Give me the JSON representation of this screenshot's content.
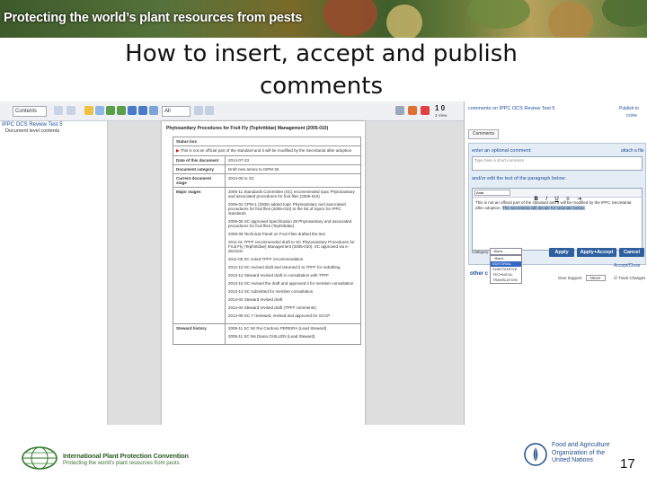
{
  "banner": {
    "text": "Protecting the world’s plant resources from pests"
  },
  "slide": {
    "title_line1": "How to insert, accept and publish",
    "title_line2": "comments",
    "page_number": "17"
  },
  "viewer": {
    "toolbar": {
      "contents_select": "Contents",
      "zoom_select": "All",
      "page_count": "1 0",
      "page_sub": "3 View"
    },
    "sidebar": {
      "tree_item": "IPPC OCS Review Test 5",
      "tree_sub": "Document level contents"
    },
    "document": {
      "title": "Phytosanitary Procedures for Fruit Fly (Tephritidae) Management (2005-010)",
      "rows": [
        {
          "key": "Status box",
          "value": ""
        },
        {
          "key": "",
          "value": "This is not an official part of the standard and it will be modified by the Secretariat after adoption"
        },
        {
          "key": "Date of this document",
          "value": "2014-07-23"
        },
        {
          "key": "Document category",
          "value": "Draft new annex to ISPM 26"
        },
        {
          "key": "Current document stage",
          "value": "2014-05 to SC"
        }
      ],
      "major_stages_key": "Major stages",
      "major_stages": [
        "2005-11 Standards Committee (SC) recommended topic Phytosanitary and associated procedures for fruit flies (2005-010)",
        "2006-04 CPM-1 (2006) added topic Phytosanitary and associated procedures for fruit flies (2005-010) to the list of topics for IPPC standards",
        "2009-05 SC approved Specification 28 Phytosanitary and associated procedures for fruit flies (Tephritidae)",
        "2009-09 Technical Panel on Fruit Flies drafted the text",
        "2011-01 TPFF recommended draft to SC Phytosanitary Procedures for Fruit Fly (Tephritidae) Management (2005-010), SC approved via e-decision",
        "2011-06 SC noted TPFF recommendation",
        "2012-10 SC revised draft and returned it to TPFF for redrafting",
        "2013-12 Steward revised draft in consultation with TPFF",
        "2013-10 SC revised the draft and approved it for member consultation",
        "2013-14 SC submitted for member consultation",
        "2014-02 Steward revised draft",
        "2014-04 Steward revised draft (TPFF comments)",
        "2014-05 SC-7 reviewed, revised and approved for SCCP"
      ],
      "steward_key": "Steward history",
      "steward_history": [
        "2009-11 SC Mr Rui Cardoso PEREIRA (Lead Steward)",
        "2005-11 SC Ms Diana GUILLÉN (Lead Steward)"
      ]
    },
    "comment_panel": {
      "header": "comments on IPPC OCS Review Test 5",
      "header_right": "Publish to",
      "header_right2": "cc/ee",
      "tab": "Comments",
      "optional_label": "enter an optional comment:",
      "attach_label": "attach a file",
      "optional_placeholder": "Type here a short comment",
      "edit_label": "and/or edit the text of the paragraph below:",
      "font_select": "Arial",
      "editor_text": "This is not an official part of the standard and it will be modified by the IPPC Secretariat after adoption. ",
      "editor_highlight": "The Secretariat will decide for rationale below.",
      "category_label": "Category:",
      "category_value": "- Blank -",
      "category_options": [
        "- Blank -",
        "EDITORIAL",
        "SUBSTANTIVE",
        "TECHNICAL",
        "TRANSLATION"
      ],
      "category_selected": "EDITORIAL",
      "apply_label": "Apply",
      "apply_accept_label": "Apply+Accept",
      "cancel_label": "Cancel",
      "accept_close_label": "Accept/Close",
      "other_label": "other c",
      "give_support": "Give Support",
      "never_label": "Never",
      "track_changes": "Track Changes"
    }
  },
  "footer": {
    "org_name": "International Plant Protection Convention",
    "org_tagline": "Protecting the world’s plant resources from pests",
    "fao_text": "Food and Agriculture Organization of the United Nations"
  },
  "colors": {
    "link_blue": "#1c4f9c",
    "button_blue": "#2f5f9e",
    "flag_red": "#d01010",
    "banner_green": "#3d5a2a"
  }
}
